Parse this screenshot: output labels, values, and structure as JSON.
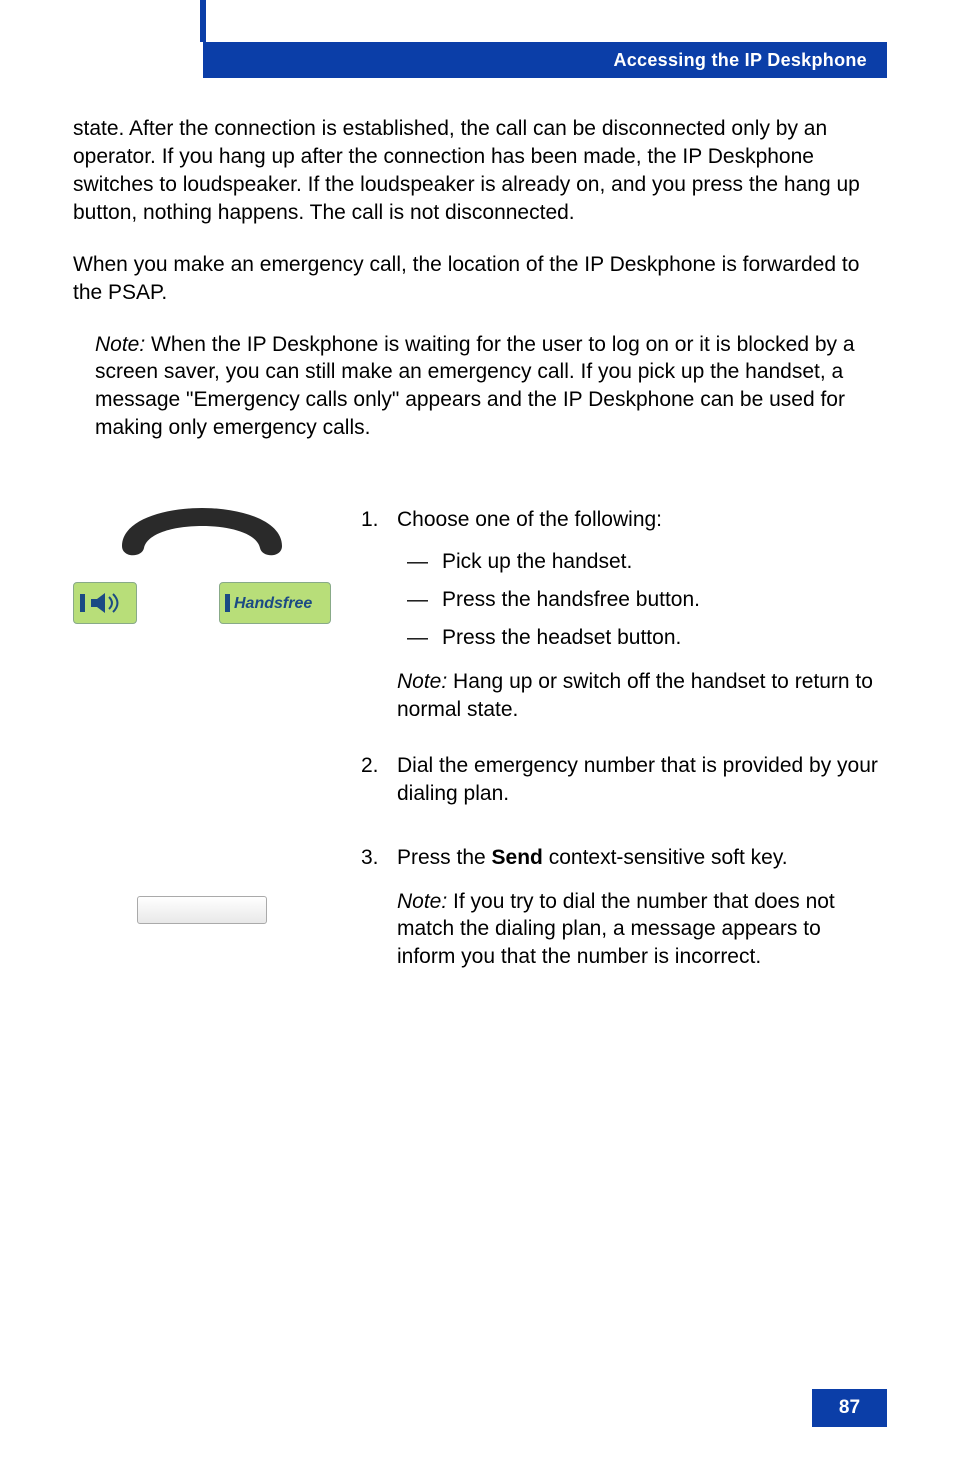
{
  "header": {
    "title": "Accessing the IP Deskphone"
  },
  "paragraphs": {
    "p1": "state. After the connection is established, the call can be disconnected only by an operator. If you hang up after the connection has been made, the IP Deskphone switches to loudspeaker. If the loudspeaker is already on, and you press the hang up button, nothing happens. The call is not disconnected.",
    "p2": "When you make an emergency call, the location of the IP Deskphone is forwarded to the PSAP."
  },
  "note1": {
    "label": "Note:",
    "text": " When the IP Deskphone is waiting for the user to log on or it is blocked by a screen saver, you can still make an emergency call. If you pick up the handset, a message \"Emergency calls only\" appears and the IP Deskphone can be used for making only emergency calls."
  },
  "handsfree_label": "Handsfree",
  "steps": {
    "s1": {
      "num": "1.",
      "lead": "Choose one of the following:",
      "opts": {
        "a": "Pick up the handset.",
        "b": "Press the handsfree button.",
        "c": "Press the headset button."
      },
      "note": {
        "label": "Note:",
        "text": " Hang up or switch off the handset to return to normal state."
      }
    },
    "s2": {
      "num": "2.",
      "text": "Dial the emergency number that is provided by your dialing plan."
    },
    "s3": {
      "num": "3.",
      "pre": "Press the ",
      "send": "Send",
      "post": " context-sensitive soft key.",
      "note": {
        "label": "Note:",
        "text": " If you try to dial the number that does not match the dialing plan, a message appears to inform you that the number is incorrect."
      }
    }
  },
  "page_number": "87"
}
